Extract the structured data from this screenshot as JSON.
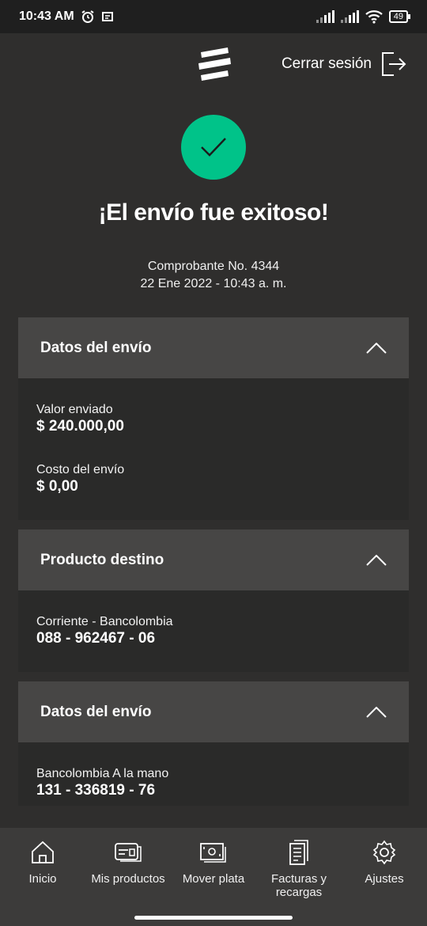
{
  "status_bar": {
    "time": "10:43 AM",
    "battery": "49"
  },
  "header": {
    "logout_label": "Cerrar sesión"
  },
  "success": {
    "title": "¡El envío fue exitoso!",
    "receipt": "Comprobante No. 4344",
    "datetime": "22 Ene 2022 - 10:43 a. m."
  },
  "cards": [
    {
      "title": "Datos del envío",
      "items": [
        {
          "label": "Valor enviado",
          "value": "$ 240.000,00"
        },
        {
          "label": "Costo del envío",
          "value": "$ 0,00"
        }
      ]
    },
    {
      "title": "Producto destino",
      "items": [
        {
          "label": "Corriente - Bancolombia",
          "value": "088 - 962467 - 06"
        }
      ]
    },
    {
      "title": "Datos del envío",
      "items": [
        {
          "label": "Bancolombia A la mano",
          "value": "131 - 336819 - 76"
        }
      ]
    }
  ],
  "nav": {
    "home": "Inicio",
    "products": "Mis productos",
    "move": "Mover plata",
    "bills": "Facturas y recargas",
    "settings": "Ajustes"
  },
  "colors": {
    "accent": "#00c389",
    "background": "#2f2e2d",
    "card_header": "#474645"
  }
}
